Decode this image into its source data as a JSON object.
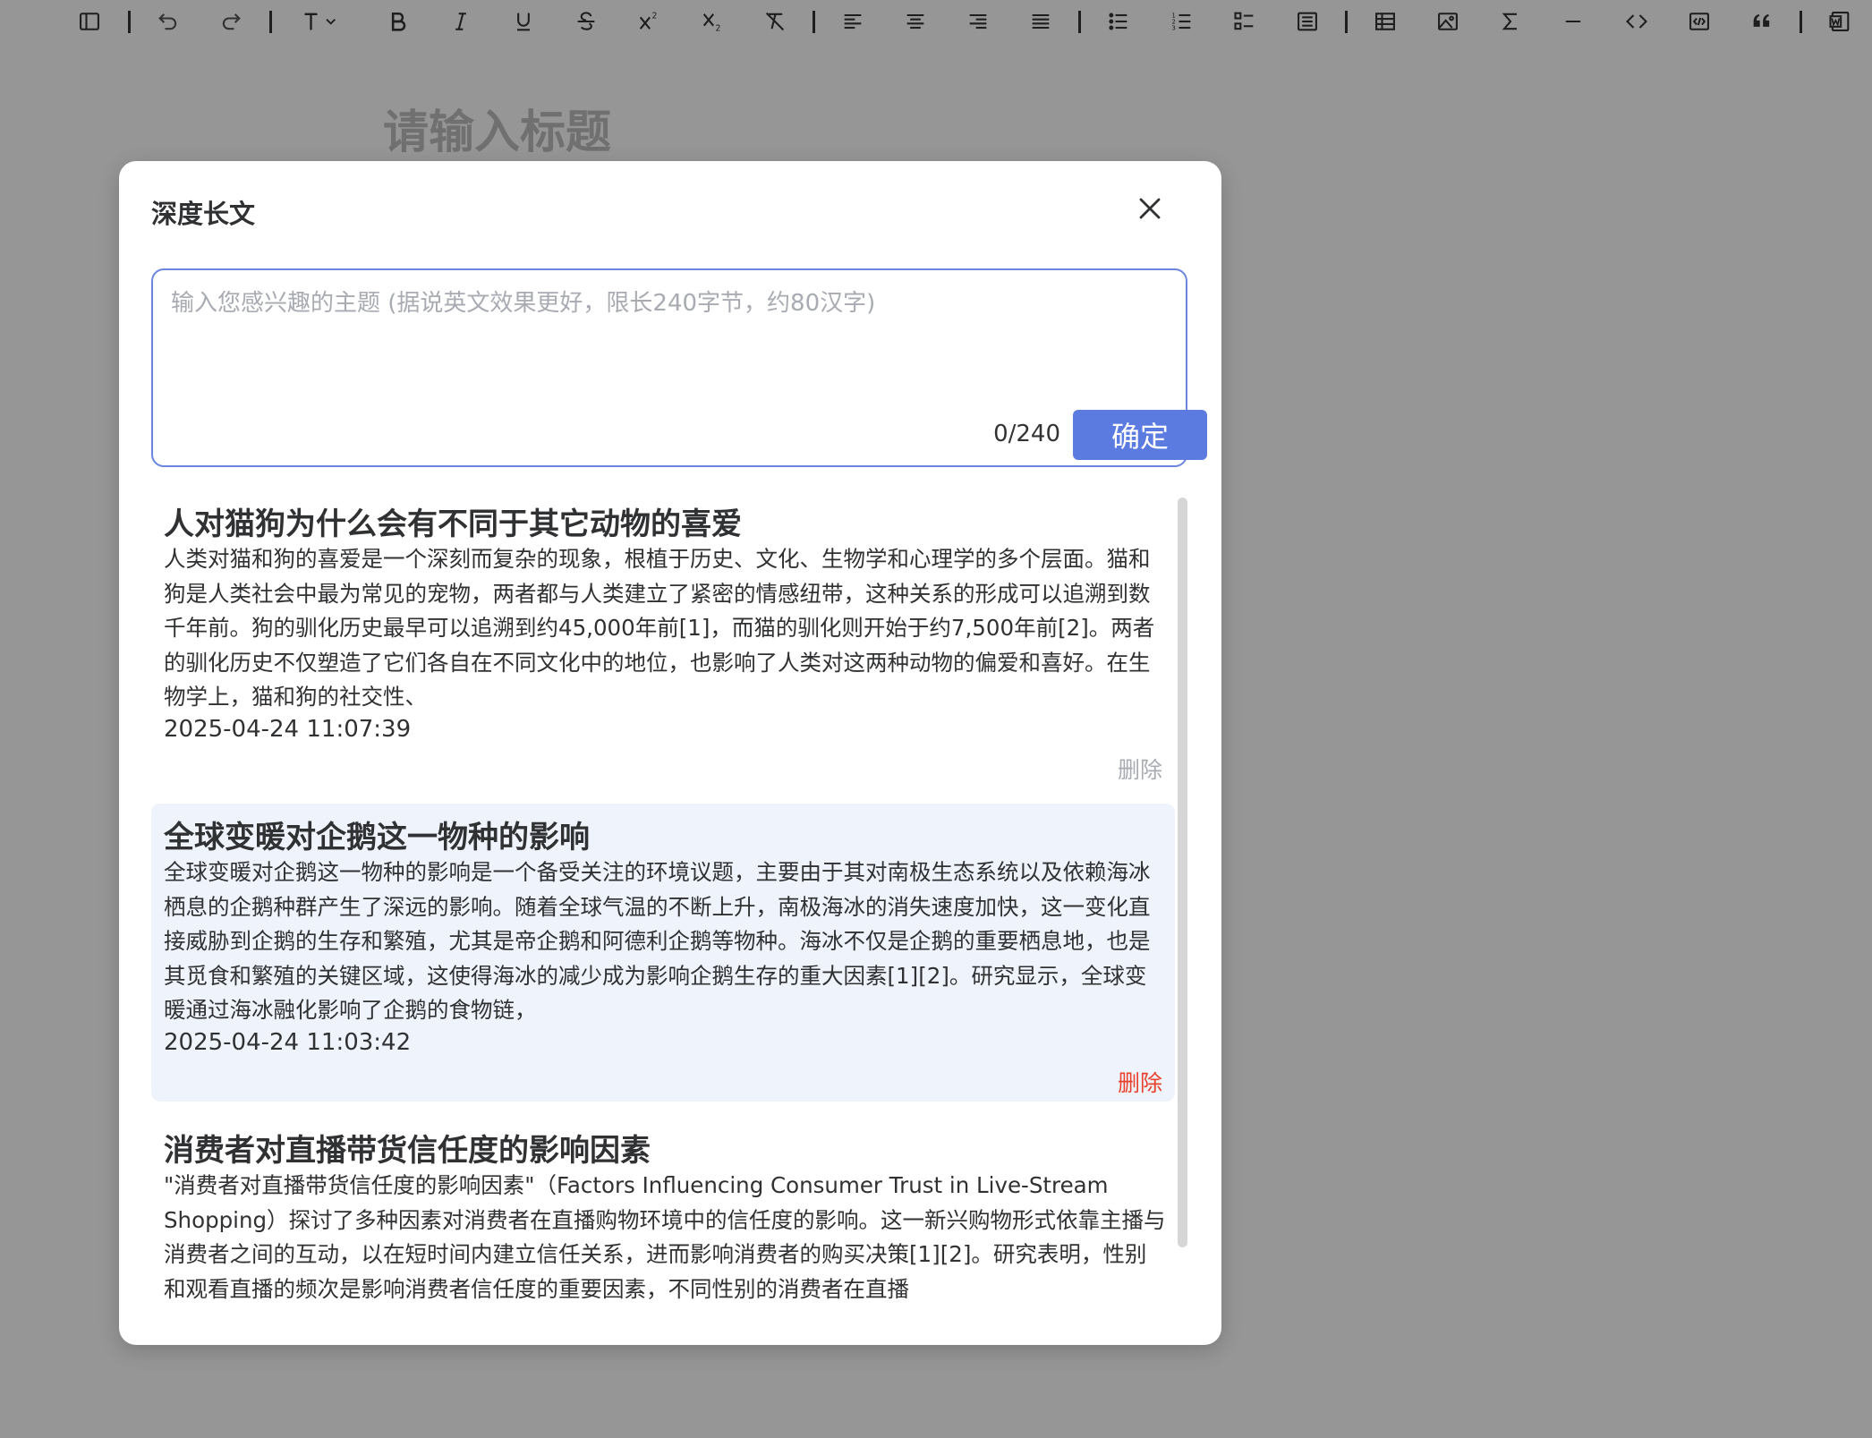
{
  "editor": {
    "title_placeholder": "请输入标题"
  },
  "toolbar": {
    "items": [
      {
        "icon": "sidebar-toggle-icon"
      },
      {
        "icon": "undo-icon"
      },
      {
        "icon": "redo-icon"
      },
      {
        "icon": "heading-icon"
      },
      {
        "icon": "bold-icon"
      },
      {
        "icon": "italic-icon"
      },
      {
        "icon": "underline-icon"
      },
      {
        "icon": "strikethrough-icon"
      },
      {
        "icon": "superscript-icon"
      },
      {
        "icon": "subscript-icon"
      },
      {
        "icon": "clear-format-icon"
      },
      {
        "icon": "align-left-icon"
      },
      {
        "icon": "align-center-icon"
      },
      {
        "icon": "align-right-icon"
      },
      {
        "icon": "align-justify-icon"
      },
      {
        "icon": "bullet-list-icon"
      },
      {
        "icon": "ordered-list-icon"
      },
      {
        "icon": "task-list-icon"
      },
      {
        "icon": "table-of-contents-icon"
      },
      {
        "icon": "table-icon"
      },
      {
        "icon": "image-icon"
      },
      {
        "icon": "formula-icon"
      },
      {
        "icon": "horizontal-rule-icon"
      },
      {
        "icon": "inline-code-icon"
      },
      {
        "icon": "code-block-icon"
      },
      {
        "icon": "blockquote-icon"
      },
      {
        "icon": "word-export-icon"
      }
    ]
  },
  "dialog": {
    "title": "深度长文",
    "input": {
      "placeholder": "输入您感兴趣的主题 (据说英文效果更好，限长240字节，约80汉字)",
      "value": "",
      "char_count": "0/240"
    },
    "confirm_label": "确定",
    "items": [
      {
        "title": "人对猫狗为什么会有不同于其它动物的喜爱",
        "summary": "人类对猫和狗的喜爱是一个深刻而复杂的现象，根植于历史、文化、生物学和心理学的多个层面。猫和狗是人类社会中最为常见的宠物，两者都与人类建立了紧密的情感纽带，这种关系的形成可以追溯到数千年前。狗的驯化历史最早可以追溯到约45,000年前[1]，而猫的驯化则开始于约7,500年前[2]。两者的驯化历史不仅塑造了它们各自在不同文化中的地位，也影响了人类对这两种动物的偏爱和喜好。在生物学上，猫和狗的社交性、",
        "date": "2025-04-24 11:07:39",
        "delete_label": "删除"
      },
      {
        "title": "全球变暖对企鹅这一物种的影响",
        "summary": "全球变暖对企鹅这一物种的影响是一个备受关注的环境议题，主要由于其对南极生态系统以及依赖海冰栖息的企鹅种群产生了深远的影响。随着全球气温的不断上升，南极海冰的消失速度加快，这一变化直接威胁到企鹅的生存和繁殖，尤其是帝企鹅和阿德利企鹅等物种。海冰不仅是企鹅的重要栖息地，也是其觅食和繁殖的关键区域，这使得海冰的减少成为影响企鹅生存的重大因素[1][2]。研究显示，全球变暖通过海冰融化影响了企鹅的食物链，",
        "date": "2025-04-24 11:03:42",
        "delete_label": "删除"
      },
      {
        "title": "消费者对直播带货信任度的影响因素",
        "summary": "\"消费者对直播带货信任度的影响因素\"（Factors Influencing Consumer Trust in Live-Stream Shopping）探讨了多种因素对消费者在直播购物环境中的信任度的影响。这一新兴购物形式依靠主播与消费者之间的互动，以在短时间内建立信任关系，进而影响消费者的购买决策[1][2]。研究表明，性别和观看直播的频次是影响消费者信任度的重要因素，不同性别的消费者在直播",
        "date": "",
        "delete_label": ""
      }
    ]
  },
  "colors": {
    "accent": "#5b7be0",
    "input_border": "#6c85e0",
    "delete_active": "#e8422c",
    "delete_muted": "#a8abb2",
    "item_hover_bg": "#eff3fb"
  }
}
